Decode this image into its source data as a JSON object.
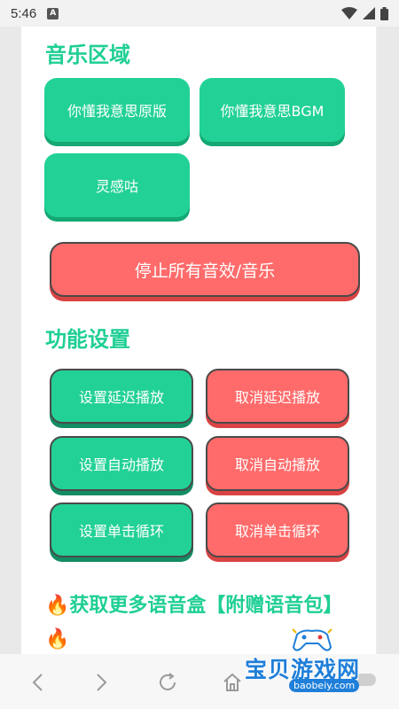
{
  "status_bar": {
    "time": "5:46",
    "notification_badge": "A"
  },
  "sections": {
    "music": {
      "title": "音乐区域",
      "buttons": [
        "你懂我意思原版",
        "你懂我意思BGM",
        "灵感咕"
      ],
      "stop_all": "停止所有音效/音乐"
    },
    "settings": {
      "title": "功能设置",
      "set_delay": "设置延迟播放",
      "cancel_delay": "取消延迟播放",
      "set_auto": "设置自动播放",
      "cancel_auto": "取消自动播放",
      "set_loop": "设置单击循环",
      "cancel_loop": "取消单击循环"
    }
  },
  "promo": {
    "fire": "🔥",
    "text": "获取更多语音盒【附赠语音包】"
  },
  "watermark": {
    "brand": "宝贝游戏网",
    "url": "baobeiy.com"
  },
  "colors": {
    "accent_green": "#22d196",
    "accent_red": "#ff6b6b",
    "title_green": "#1fcf95"
  },
  "icons": [
    "wifi-icon",
    "signal-icon",
    "battery-icon",
    "back-icon",
    "forward-icon",
    "refresh-icon",
    "home-icon",
    "gamepad-icon"
  ]
}
